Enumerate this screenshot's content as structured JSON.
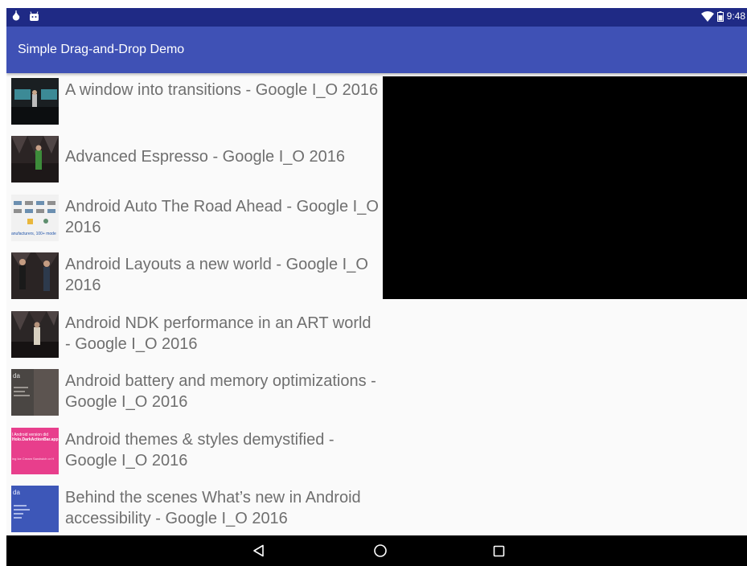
{
  "status_bar": {
    "time": "9:48",
    "icons": [
      "notification-drop-icon",
      "android-robot-icon",
      "wifi-icon",
      "battery-icon"
    ]
  },
  "app_bar": {
    "title": "Simple Drag-and-Drop Demo"
  },
  "videos": [
    {
      "title": "A window into transitions - Google I_O 2016",
      "thumb": "stage-icon"
    },
    {
      "title": "Advanced Espresso - Google I_O 2016",
      "thumb": "speaker-icon"
    },
    {
      "title": "Android Auto The Road Ahead - Google I_O 2016",
      "thumb": "slide-icon"
    },
    {
      "title": "Android Layouts a new world - Google I_O 2016",
      "thumb": "speakers-icon"
    },
    {
      "title": "Android NDK performance in an ART world - Google I_O 2016",
      "thumb": "speaker-icon"
    },
    {
      "title": "Android battery and memory optimizations - Google I_O 2016",
      "thumb": "dark-slide-icon"
    },
    {
      "title": "Android themes & styles demystified - Google I_O 2016",
      "thumb": "pink-slide-icon"
    },
    {
      "title": "Behind the scenes What’s new in Android accessibility - Google I_O 2016",
      "thumb": "blue-slide-icon"
    }
  ],
  "thumb_texts": {
    "auto_caption": "anufacturers, 100+ mode",
    "dark_slide_word": "da",
    "pink_slide_line1": "l Android version did",
    "pink_slide_line2": "Holo.DarkActionBar.app",
    "pink_slide_line3": "ing Ice Cream Sandwich or H",
    "blue_slide_word": "da"
  },
  "navigation": {
    "back_icon": "back-triangle-icon",
    "home_icon": "home-circle-icon",
    "recents_icon": "recents-square-icon"
  },
  "colors": {
    "status_bar": "#1f2a85",
    "app_bar": "#3f51b5",
    "list_background": "#fafafa",
    "title_text": "#6f6f6f",
    "video_panel": "#000000",
    "nav_bar": "#000000"
  }
}
